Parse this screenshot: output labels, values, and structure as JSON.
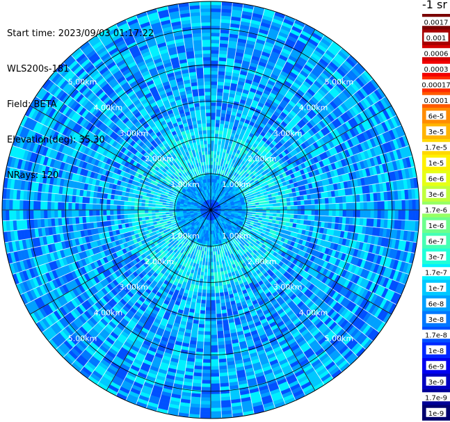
{
  "header": {
    "start_time": "Start time: 2023/09/03 01:17:22",
    "instrument": "WLS200s-181",
    "field": "Field: BETA",
    "elevation": "Elevation(deg): 35.30",
    "nrays": "NRays: 120"
  },
  "colorbar": {
    "unit": "-1 sr",
    "entries": [
      {
        "label": "0.0017",
        "color": "#7a0000"
      },
      {
        "label": "0.001",
        "color": "#a80000"
      },
      {
        "label": "0.0006",
        "color": "#d40000"
      },
      {
        "label": "0.0003",
        "color": "#f20000"
      },
      {
        "label": "0.00017",
        "color": "#ff2a00"
      },
      {
        "label": "0.0001",
        "color": "#ff5a00"
      },
      {
        "label": "6e-5",
        "color": "#ff8c00"
      },
      {
        "label": "3e-5",
        "color": "#ffb400"
      },
      {
        "label": "1.7e-5",
        "color": "#ffd800"
      },
      {
        "label": "1e-5",
        "color": "#fff000"
      },
      {
        "label": "6e-6",
        "color": "#e6ff14"
      },
      {
        "label": "3e-6",
        "color": "#c0ff3c"
      },
      {
        "label": "1.7e-6",
        "color": "#96ff64"
      },
      {
        "label": "1e-6",
        "color": "#6cff8c"
      },
      {
        "label": "6e-7",
        "color": "#46ffb4"
      },
      {
        "label": "3e-7",
        "color": "#20ffd8"
      },
      {
        "label": "1.7e-7",
        "color": "#00f0ff"
      },
      {
        "label": "1e-7",
        "color": "#00c8ff"
      },
      {
        "label": "6e-8",
        "color": "#00a0ff"
      },
      {
        "label": "3e-8",
        "color": "#0078ff"
      },
      {
        "label": "1.7e-8",
        "color": "#0050ff"
      },
      {
        "label": "1e-8",
        "color": "#0028ff"
      },
      {
        "label": "6e-9",
        "color": "#0000f0"
      },
      {
        "label": "3e-9",
        "color": "#0000c0"
      },
      {
        "label": "1.7e-9",
        "color": "#000096"
      },
      {
        "label": "1e-9",
        "color": "#00006e"
      }
    ]
  },
  "chart_data": {
    "type": "heatmap",
    "projection": "polar (PPI)",
    "field": "BETA",
    "n_rays": 120,
    "range_rings": [
      {
        "range_km": 1,
        "label": "1.00km"
      },
      {
        "range_km": 2,
        "label": "2.00km"
      },
      {
        "range_km": 3,
        "label": "3.00km"
      },
      {
        "range_km": 4,
        "label": "4.00km"
      },
      {
        "range_km": 5,
        "label": "5.00km"
      }
    ],
    "max_range_km": 5.75,
    "radial_lines_deg": [
      0,
      30,
      60,
      90,
      120,
      150,
      180,
      210,
      240,
      270,
      300,
      330
    ],
    "ring_label_azimuths_deg": [
      45,
      135,
      225,
      315
    ],
    "value_range": [
      1e-09,
      0.0017
    ],
    "value_regions": [
      {
        "range_km": [
          0.0,
          0.3
        ],
        "typical_value": "6e-8",
        "palette_indices": [
          19,
          20,
          21
        ]
      },
      {
        "range_km": [
          0.3,
          1.0
        ],
        "typical_value": "1e-7",
        "palette_indices": [
          17,
          18,
          19
        ]
      },
      {
        "range_km": [
          1.0,
          2.3
        ],
        "typical_value": "1.7e-7",
        "palette_indices": [
          15,
          16,
          17,
          18
        ]
      },
      {
        "range_km": [
          2.3,
          5.75
        ],
        "typical_value": "6e-8",
        "palette_indices": [
          16,
          17,
          18,
          19,
          20
        ]
      }
    ]
  }
}
